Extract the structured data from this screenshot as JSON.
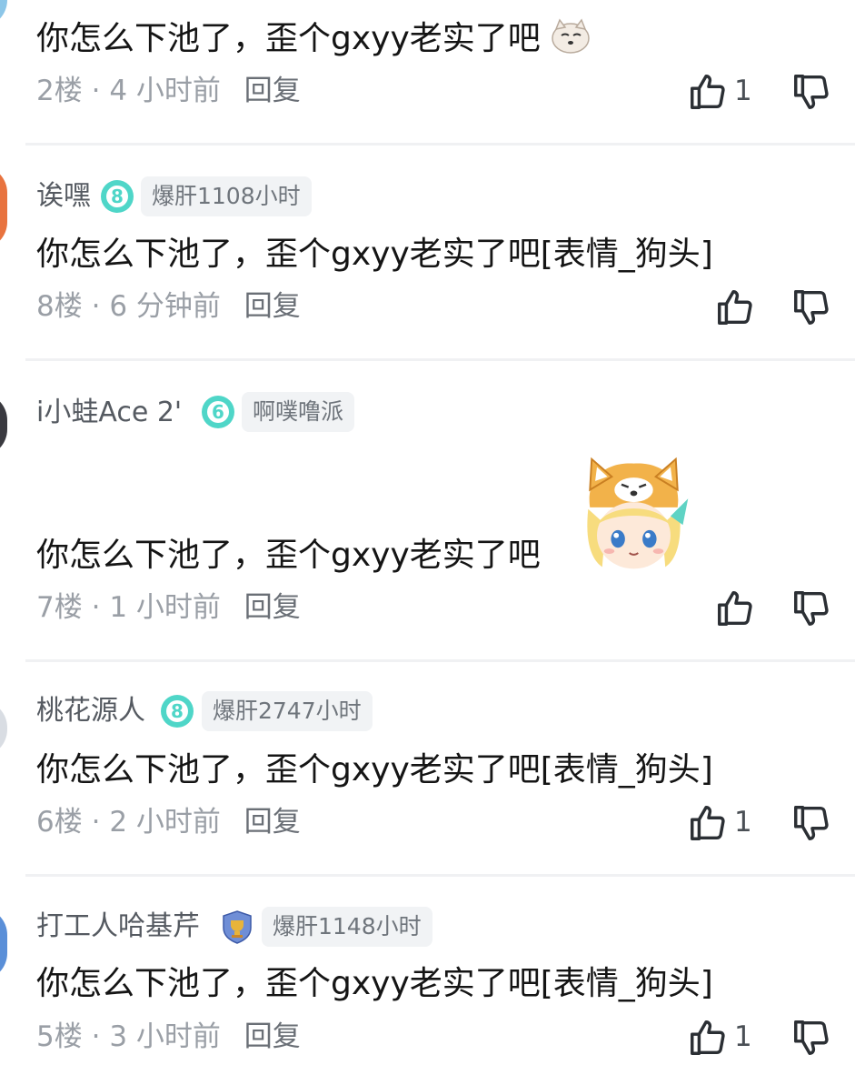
{
  "comments": [
    {
      "content": "你怎么下池了，歪个gxyy老实了吧",
      "floor": "2楼",
      "time": "4 小时前",
      "reply": "回复",
      "like_count": "1",
      "emoji": "doge-emoji"
    },
    {
      "username": "诶嘿",
      "level_icon": "level-8-icon",
      "badge": "爆肝1108小时",
      "content": "你怎么下池了，歪个gxyy老实了吧[表情_狗头]",
      "floor": "8楼",
      "time": "6 分钟前",
      "reply": "回复"
    },
    {
      "username": "i小蛙Ace  2'",
      "level_icon": "level-6-icon",
      "badge": "啊噗噜派",
      "content": "你怎么下池了，歪个gxyy老实了吧",
      "sticker": "shiba-girl-sticker",
      "floor": "7楼",
      "time": "1 小时前",
      "reply": "回复"
    },
    {
      "username": "桃花源人",
      "level_icon": "level-8-icon",
      "badge": "爆肝2747小时",
      "content": "你怎么下池了，歪个gxyy老实了吧[表情_狗头]",
      "floor": "6楼",
      "time": "2 小时前",
      "reply": "回复",
      "like_count": "1"
    },
    {
      "username": "打工人哈基芹",
      "level_icon": "trophy-shield-icon",
      "badge": "爆肝1148小时",
      "content": "你怎么下池了，歪个gxyy老实了吧[表情_狗头]",
      "floor": "5楼",
      "time": "3 小时前",
      "reply": "回复",
      "like_count": "1"
    }
  ],
  "colors": {
    "level_teal": "#4fd6c8",
    "text_gray": "#9a9fa6",
    "badge_bg": "#f1f3f5"
  }
}
